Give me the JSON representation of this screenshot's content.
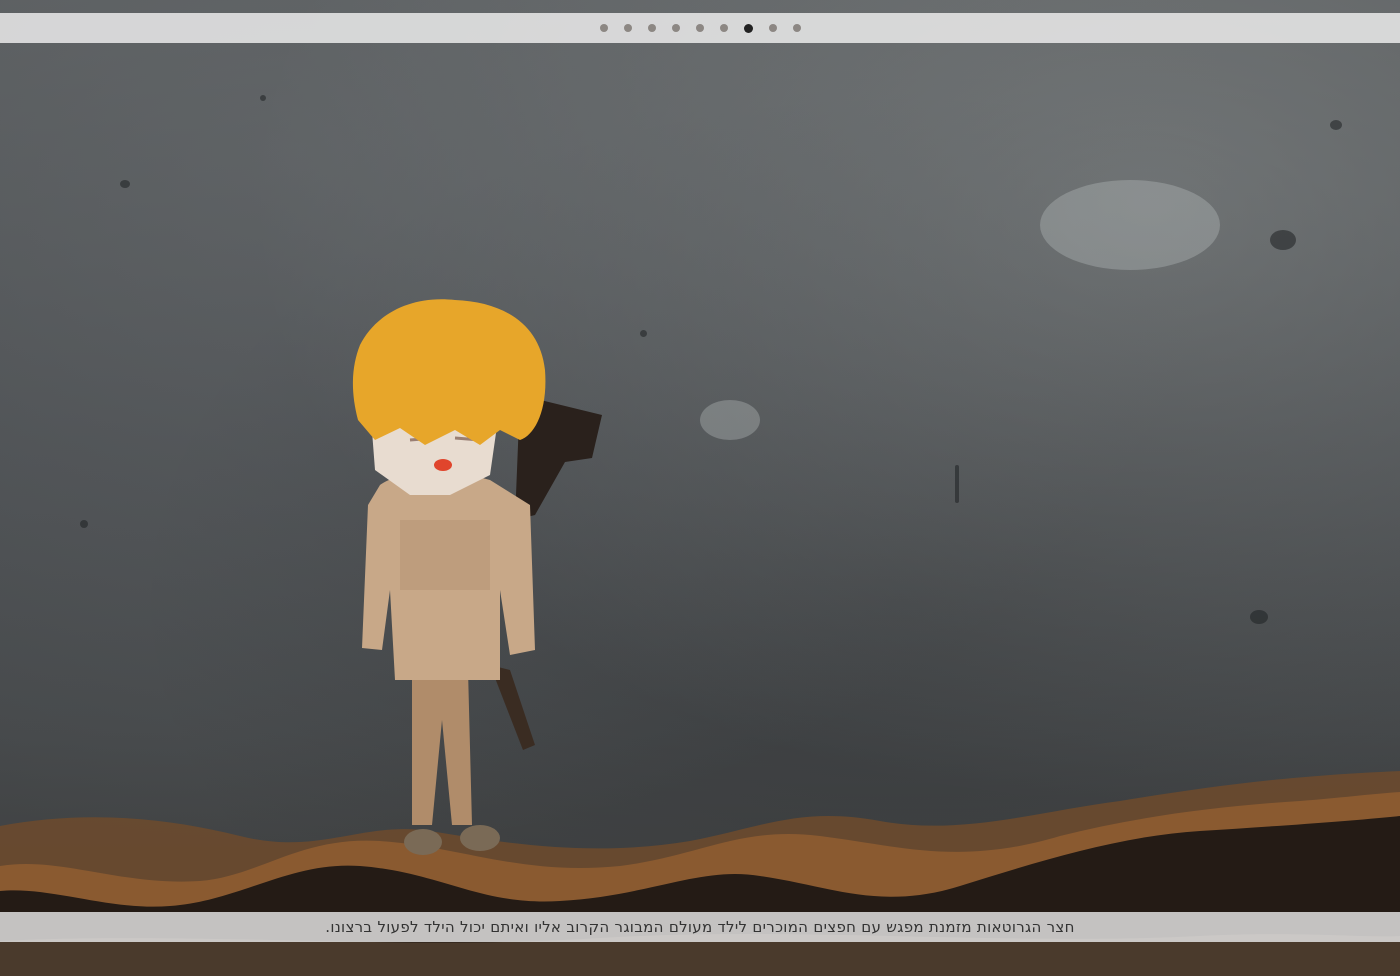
{
  "navigation": {
    "slides": [
      {
        "index": 1,
        "active": false
      },
      {
        "index": 2,
        "active": false
      },
      {
        "index": 3,
        "active": false
      },
      {
        "index": 4,
        "active": false
      },
      {
        "index": 5,
        "active": false
      },
      {
        "index": 6,
        "active": false
      },
      {
        "index": 7,
        "active": true
      },
      {
        "index": 8,
        "active": false
      },
      {
        "index": 9,
        "active": false
      }
    ]
  },
  "caption": {
    "text": "חצר הגרוטאות מזמנת מפגש עם חפצים המוכרים לילד מעולם המבוגר הקרוב אליו ואיתם יכול הילד לפעול ברצונו."
  },
  "colors": {
    "bar": "#ebebeb",
    "dot": "#8c8783",
    "dot_active": "#222222",
    "caption_text": "#333333"
  }
}
